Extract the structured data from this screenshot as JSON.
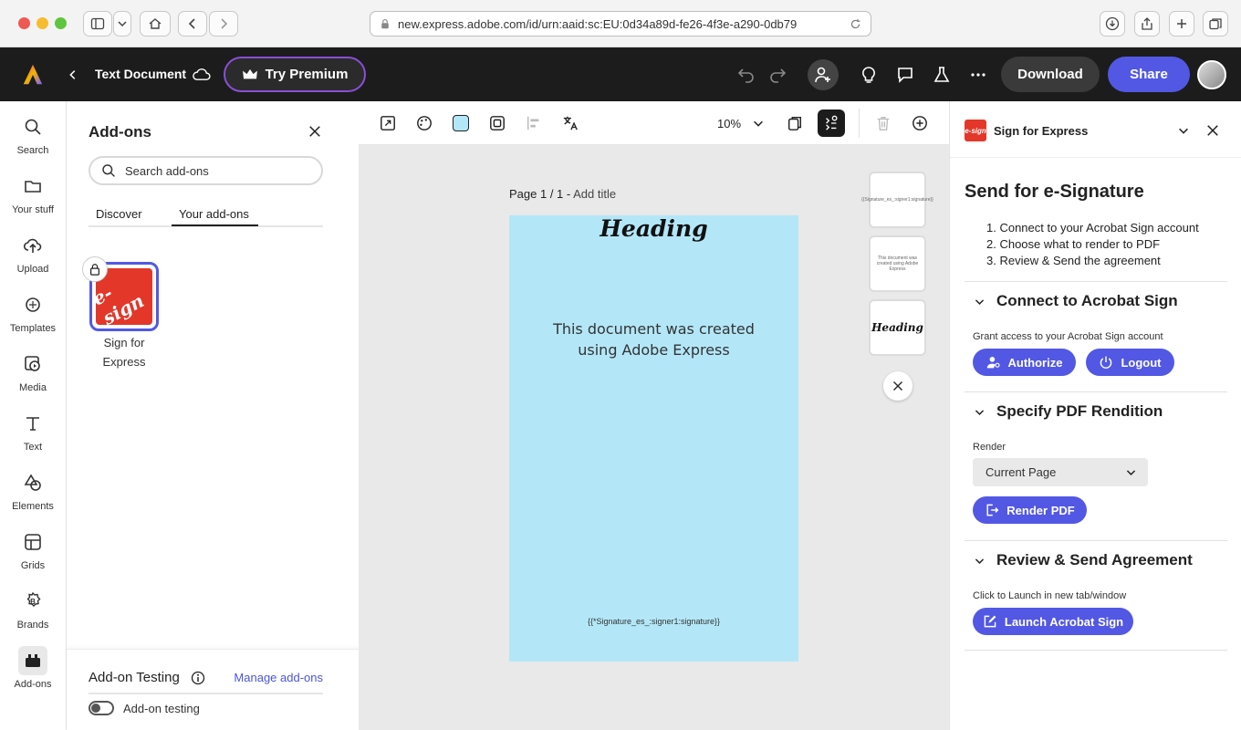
{
  "browser": {
    "url": "new.express.adobe.com/id/urn:aaid:sc:EU:0d34a89d-fe26-4f3e-a290-0db79"
  },
  "app": {
    "doc_title": "Text Document",
    "try_premium": "Try Premium",
    "download": "Download",
    "share": "Share"
  },
  "rail": {
    "items": [
      {
        "label": "Search",
        "icon": "search-icon"
      },
      {
        "label": "Your stuff",
        "icon": "folder-icon"
      },
      {
        "label": "Upload",
        "icon": "upload-icon"
      },
      {
        "label": "Templates",
        "icon": "templates-icon"
      },
      {
        "label": "Media",
        "icon": "media-icon"
      },
      {
        "label": "Text",
        "icon": "text-icon"
      },
      {
        "label": "Elements",
        "icon": "elements-icon"
      },
      {
        "label": "Grids",
        "icon": "grids-icon"
      },
      {
        "label": "Brands",
        "icon": "brands-icon"
      },
      {
        "label": "Add-ons",
        "icon": "addons-icon"
      }
    ]
  },
  "addons": {
    "title": "Add-ons",
    "search_placeholder": "Search add-ons",
    "tab_discover": "Discover",
    "tab_your": "Your add-ons",
    "addon_name_1": "Sign for",
    "addon_name_2": "Express",
    "addon_logo_text": "e-sign",
    "testing_title": "Add-on Testing",
    "manage_link": "Manage add-ons",
    "testing_toggle": "Add-on testing"
  },
  "canvas": {
    "zoom": "10%",
    "page_label": "Page 1 / 1 - ",
    "page_add_title": "Add title",
    "heading": "Heading",
    "body_line1": "This document was created",
    "body_line2": "using Adobe Express",
    "signature_tag": "{{*Signature_es_:signer1:signature}}",
    "thumb1_text": "{{Signature_es_:signer1:signature}}",
    "thumb2_text": "This document was created using Adobe Express",
    "thumb3_text": "Heading"
  },
  "sign_panel": {
    "header_title": "Sign for Express",
    "logo_text": "e-sign",
    "main_title": "Send for e-Signature",
    "steps": [
      "1.  Connect to your Acrobat Sign account",
      "2.  Choose what to render to PDF",
      "3.  Review & Send the agreement"
    ],
    "connect_title": "Connect to Acrobat Sign",
    "grant_label": "Grant access to your Acrobat Sign account",
    "authorize": "Authorize",
    "logout": "Logout",
    "pdf_title": "Specify PDF Rendition",
    "render_label": "Render",
    "render_value": "Current Page",
    "render_btn": "Render PDF",
    "review_title": "Review & Send Agreement",
    "launch_label": "Click to Launch in new tab/window",
    "launch_btn": "Launch Acrobat Sign"
  },
  "colors": {
    "accent": "#5258e4",
    "page_bg": "#b3e7f8",
    "esign_red": "#e3372a"
  }
}
